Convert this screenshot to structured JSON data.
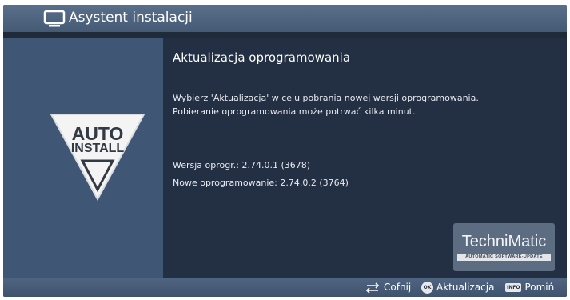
{
  "header": {
    "title": "Asystent instalacji",
    "icon": "tv-icon"
  },
  "left_panel": {
    "badge_icon": "auto-install-icon",
    "badge_line1": "AUTO",
    "badge_line2": "INSTALL"
  },
  "main": {
    "headline": "Aktualizacja oprogramowania",
    "description_line1": "Wybierz 'Aktualizacja' w celu pobrania nowej wersji oprogramowania.",
    "description_line2": "Pobieranie oprogramowania może potrwać kilka minut.",
    "version_current": "Wersja oprogr.: 2.74.0.1 (3678)",
    "version_new": "Nowe oprogramowanie: 2.74.0.2 (3764)"
  },
  "brand": {
    "name": "TechniMatic",
    "subtitle": "AUTOMATIC SOFTWARE-UPDATE"
  },
  "footer": {
    "back_icon": "back-arrows-icon",
    "back_label": "Cofnij",
    "ok_key": "OK",
    "ok_label": "Aktualizacja",
    "info_key": "INFO",
    "info_label": "Pomiń"
  },
  "colors": {
    "header": "#4f6480",
    "left_panel": "#3f5674",
    "main_panel": "#232f42",
    "text": "#ffffff"
  }
}
